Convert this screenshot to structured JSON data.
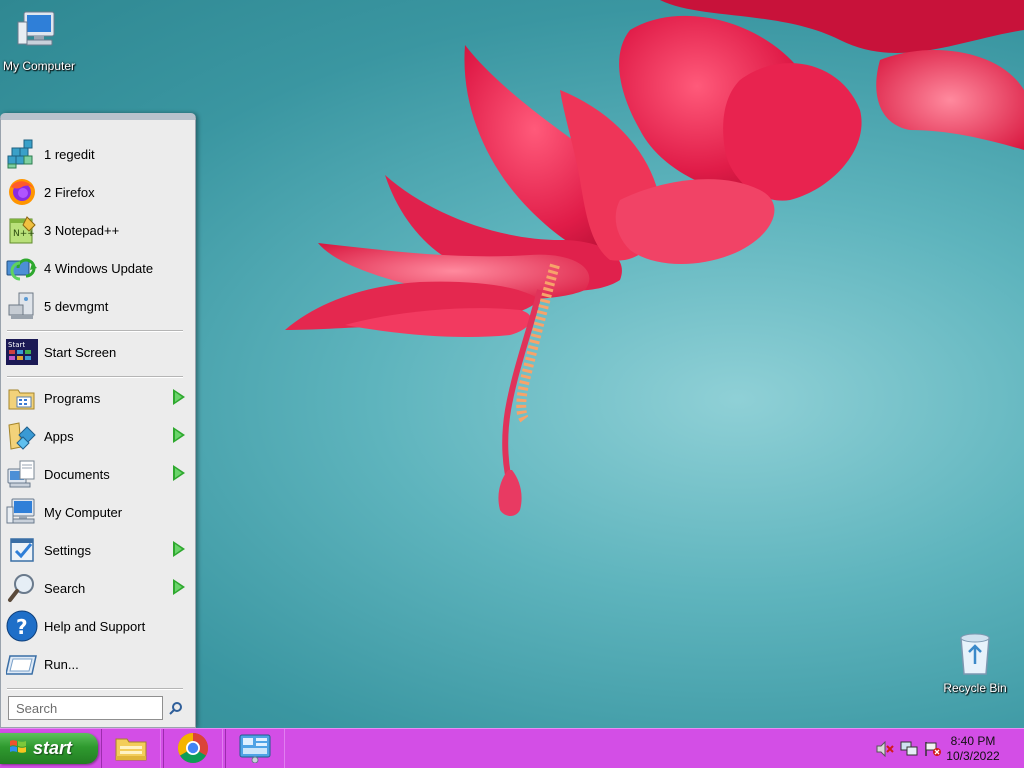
{
  "desktop": {
    "icons": [
      {
        "label": "My Computer",
        "icon": "computer-icon"
      },
      {
        "label": "Recycle Bin",
        "icon": "recycle-bin-icon"
      }
    ]
  },
  "start_menu": {
    "recent": [
      {
        "label": "1 regedit",
        "icon": "registry-editor-icon"
      },
      {
        "label": "2 Firefox",
        "icon": "firefox-icon"
      },
      {
        "label": "3 Notepad++",
        "icon": "notepad-plus-plus-icon"
      },
      {
        "label": "4 Windows Update",
        "icon": "windows-update-icon"
      },
      {
        "label": "5 devmgmt",
        "icon": "device-manager-icon"
      }
    ],
    "start_screen": {
      "label": "Start Screen",
      "icon": "start-screen-icon"
    },
    "main": [
      {
        "label": "Programs",
        "icon": "programs-folder-icon",
        "submenu": true
      },
      {
        "label": "Apps",
        "icon": "apps-icon",
        "submenu": true
      },
      {
        "label": "Documents",
        "icon": "documents-icon",
        "submenu": true
      },
      {
        "label": "My Computer",
        "icon": "computer-icon",
        "submenu": false
      },
      {
        "label": "Settings",
        "icon": "settings-icon",
        "submenu": true
      },
      {
        "label": "Search",
        "icon": "magnifier-icon",
        "submenu": true
      },
      {
        "label": "Help and Support",
        "icon": "help-icon",
        "submenu": false
      },
      {
        "label": "Run...",
        "icon": "run-icon",
        "submenu": false
      }
    ],
    "search": {
      "placeholder": "Search"
    }
  },
  "taskbar": {
    "start_label": "start",
    "pinned": [
      {
        "icon": "file-explorer-icon"
      },
      {
        "icon": "chrome-icon"
      },
      {
        "icon": "control-panel-icon"
      }
    ],
    "tray": {
      "icons": [
        "volume-muted-icon",
        "network-icon",
        "action-center-flag-icon"
      ],
      "time": "8:40 PM",
      "date": "10/3/2022"
    }
  },
  "colors": {
    "taskbar": "#d34ee6",
    "start_button": "#2f9a2f",
    "wallpaper": "#4aa5ae",
    "submenu_arrow": "#2ea82e"
  }
}
